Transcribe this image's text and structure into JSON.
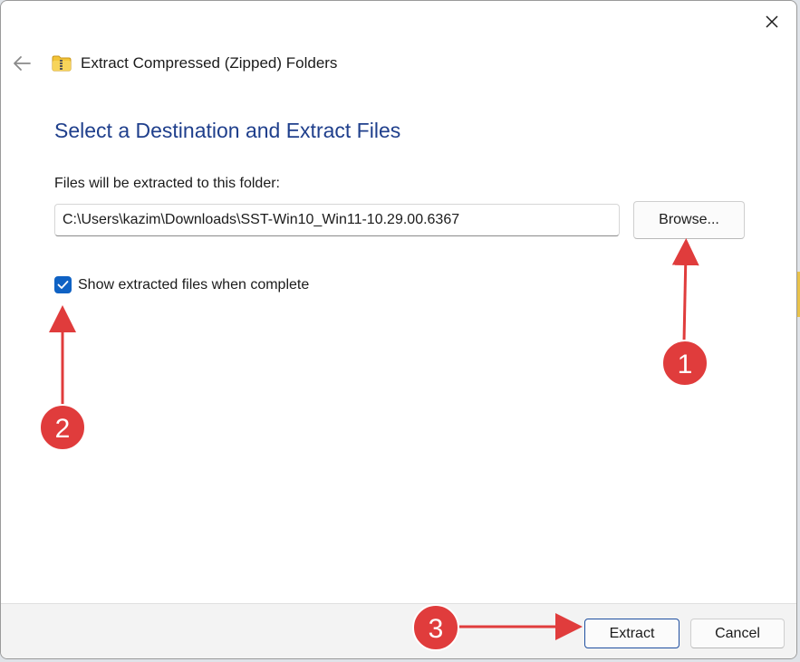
{
  "window": {
    "title": "Extract Compressed (Zipped) Folders",
    "close_icon": "close-icon",
    "back_icon": "back-arrow-icon",
    "folder_icon": "zip-folder-icon"
  },
  "main": {
    "heading": "Select a Destination and Extract Files",
    "destination_label": "Files will be extracted to this folder:",
    "destination_value": "C:\\Users\\kazim\\Downloads\\SST-Win10_Win11-10.29.00.6367",
    "browse_label": "Browse...",
    "show_files_label": "Show extracted files when complete",
    "show_files_checked": true
  },
  "footer": {
    "extract_label": "Extract",
    "cancel_label": "Cancel"
  },
  "annotations": {
    "markers": [
      "1",
      "2",
      "3"
    ],
    "color": "#e03c3c"
  },
  "colors": {
    "accent": "#0f62c4",
    "heading": "#1f3f8c",
    "annotation": "#e03c3c"
  }
}
